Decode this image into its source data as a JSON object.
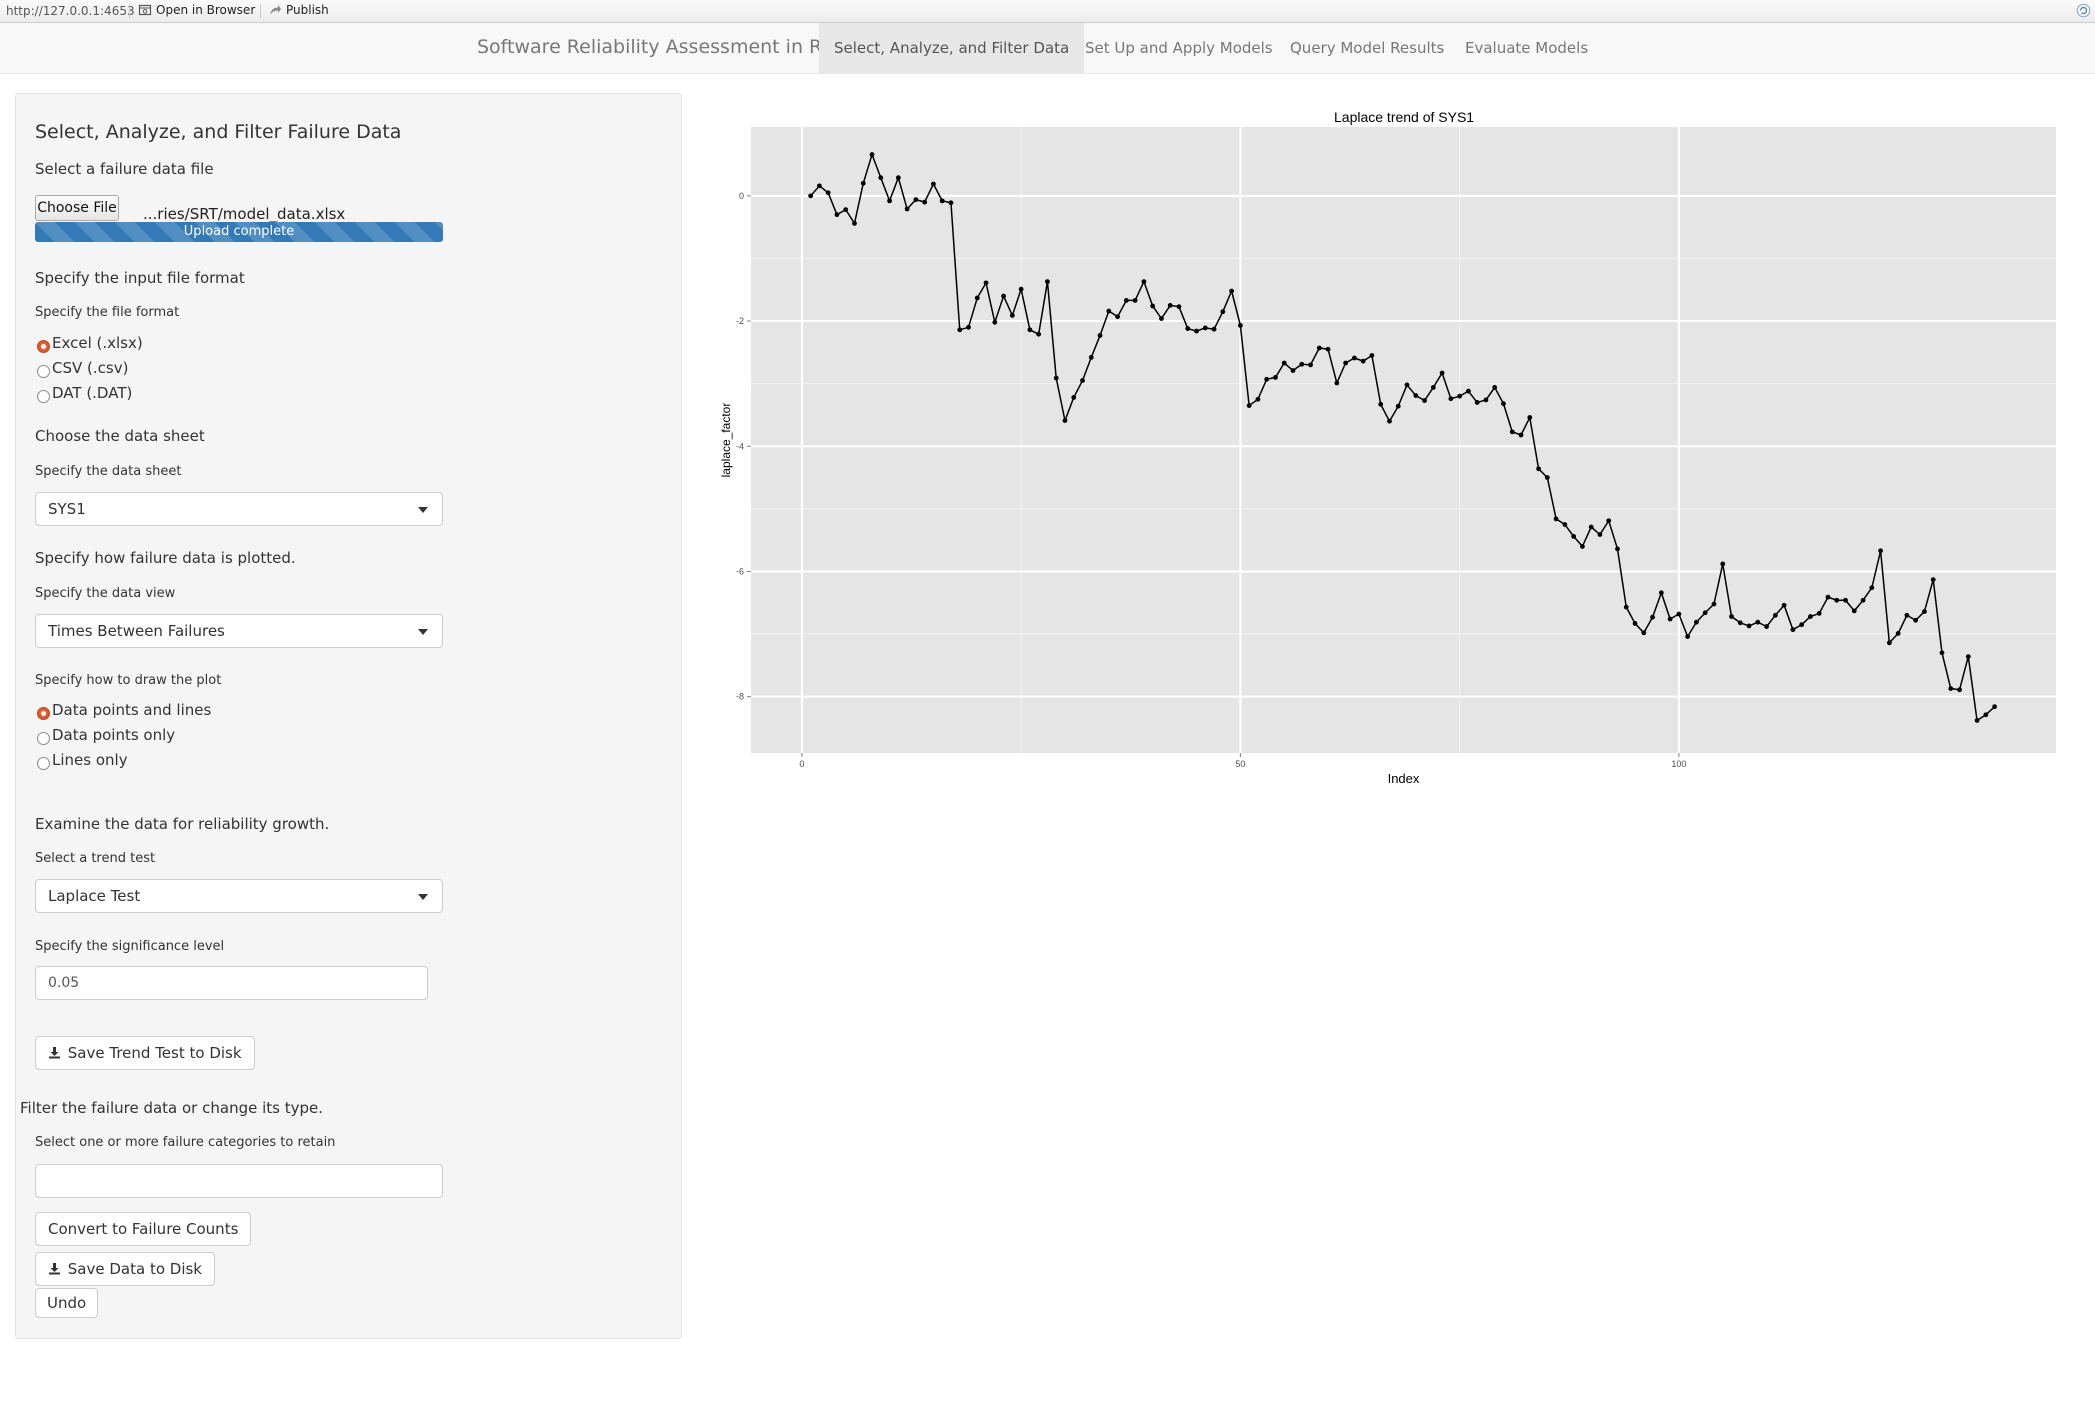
{
  "topbar": {
    "url": "http://127.0.0.1:4653",
    "open_browser": "Open in Browser",
    "publish": "Publish"
  },
  "navbar": {
    "brand": "Software Reliability Assessment in R",
    "tabs": [
      {
        "label": "Select, Analyze, and Filter Data",
        "active": true
      },
      {
        "label": "Set Up and Apply Models"
      },
      {
        "label": "Query Model Results"
      },
      {
        "label": "Evaluate Models"
      }
    ]
  },
  "sidebar": {
    "title": "Select, Analyze, and Filter Failure Data",
    "file_label": "Select a failure data file",
    "choose_file": "Choose File",
    "filename": "...ries/SRT/model_data.xlsx",
    "upload_status": "Upload complete",
    "format_heading": "Specify the input file format",
    "format_label": "Specify the file format",
    "format_options": [
      "Excel (.xlsx)",
      "CSV (.csv)",
      "DAT (.DAT)"
    ],
    "sheet_heading": "Choose the data sheet",
    "sheet_label": "Specify the data sheet",
    "sheet_value": "SYS1",
    "plot_heading": "Specify how failure data is plotted.",
    "view_label": "Specify the data view",
    "view_value": "Times Between Failures",
    "draw_label": "Specify how to draw the plot",
    "draw_options": [
      "Data points and lines",
      "Data points only",
      "Lines only"
    ],
    "growth_heading": "Examine the data for reliability growth.",
    "trend_label": "Select a trend test",
    "trend_value": "Laplace Test",
    "sig_label": "Specify the significance level",
    "sig_value": "0.05",
    "save_trend": "Save Trend Test to Disk",
    "filter_heading": "Filter the failure data or change its type.",
    "categories_label": "Select one or more failure categories to retain",
    "convert_btn": "Convert to Failure Counts",
    "save_data": "Save Data to Disk",
    "undo": "Undo"
  },
  "colors": {
    "panel_bg": "#f5f5f5",
    "plot_bg": "#e5e5e5",
    "progress": "#337ab7",
    "radio_checked": "#e05a2b"
  },
  "chart_data": {
    "type": "line",
    "title": "Laplace trend of  SYS1",
    "xlabel": "Index",
    "ylabel": "laplace_factor",
    "xlim": [
      -5.8,
      143
    ],
    "ylim": [
      -8.9,
      1.1
    ],
    "x_ticks": [
      0,
      50,
      100
    ],
    "y_ticks": [
      0,
      -2,
      -4,
      -6,
      -8
    ],
    "grid": true,
    "style": "points_and_lines",
    "x_start": 1,
    "values": [
      0.0,
      0.16,
      0.05,
      -0.3,
      -0.22,
      -0.44,
      0.2,
      0.66,
      0.29,
      -0.08,
      0.29,
      -0.21,
      -0.06,
      -0.1,
      0.19,
      -0.08,
      -0.11,
      -2.14,
      -2.1,
      -1.63,
      -1.39,
      -2.02,
      -1.6,
      -1.91,
      -1.49,
      -2.14,
      -2.21,
      -1.37,
      -2.91,
      -3.59,
      -3.22,
      -2.95,
      -2.58,
      -2.23,
      -1.84,
      -1.93,
      -1.67,
      -1.67,
      -1.37,
      -1.76,
      -1.96,
      -1.75,
      -1.77,
      -2.12,
      -2.16,
      -2.11,
      -2.13,
      -1.85,
      -1.52,
      -2.07,
      -3.35,
      -3.25,
      -2.93,
      -2.9,
      -2.67,
      -2.79,
      -2.69,
      -2.7,
      -2.43,
      -2.45,
      -2.99,
      -2.67,
      -2.59,
      -2.64,
      -2.55,
      -3.33,
      -3.6,
      -3.36,
      -3.02,
      -3.19,
      -3.27,
      -3.06,
      -2.83,
      -3.24,
      -3.2,
      -3.12,
      -3.3,
      -3.26,
      -3.06,
      -3.32,
      -3.77,
      -3.82,
      -3.54,
      -4.36,
      -4.5,
      -5.16,
      -5.25,
      -5.44,
      -5.6,
      -5.29,
      -5.41,
      -5.19,
      -5.64,
      -6.57,
      -6.83,
      -6.98,
      -6.73,
      -6.34,
      -6.76,
      -6.68,
      -7.04,
      -6.81,
      -6.66,
      -6.52,
      -5.88,
      -6.72,
      -6.82,
      -6.87,
      -6.81,
      -6.88,
      -6.7,
      -6.54,
      -6.93,
      -6.85,
      -6.72,
      -6.67,
      -6.41,
      -6.46,
      -6.46,
      -6.63,
      -6.46,
      -6.26,
      -5.67,
      -7.14,
      -6.99,
      -6.7,
      -6.78,
      -6.64,
      -6.13,
      -7.3,
      -7.87,
      -7.89,
      -7.36,
      -8.38,
      -8.29,
      -8.16
    ]
  }
}
